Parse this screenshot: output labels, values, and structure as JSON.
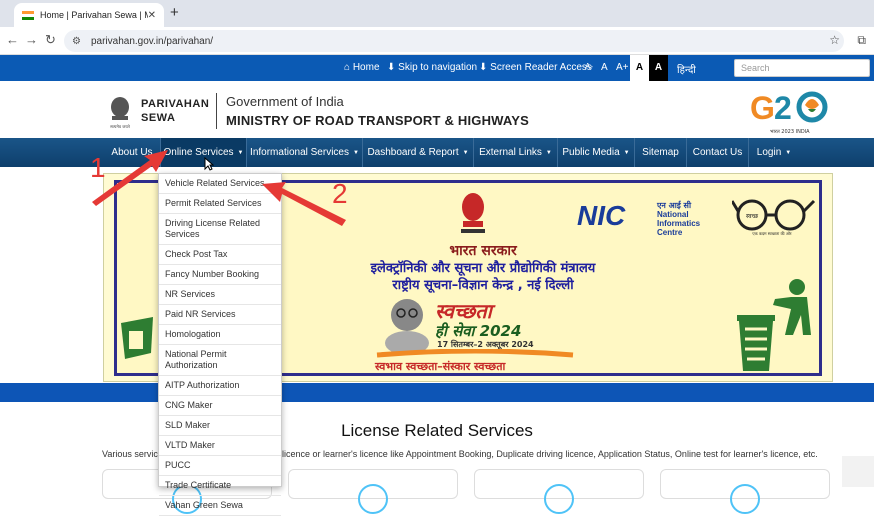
{
  "browser": {
    "tab_title": "Home | Parivahan Sewa | Minis",
    "new_tab": "+",
    "url": "parivahan.gov.in/parivahan/"
  },
  "utility": {
    "home": "Home",
    "skip": "Skip to navigation",
    "screen_reader": "Screen Reader Access",
    "font_small": "A-",
    "font_normal": "A",
    "font_large": "A+",
    "theme_light": "A",
    "theme_dark": "A",
    "lang": "हिन्दी",
    "search_placeholder": "Search"
  },
  "header": {
    "brand_line1": "PARIVAHAN",
    "brand_line2": "SEWA",
    "emblem_caption": "सत्यमेव जयते",
    "gov": "Government of India",
    "ministry": "MINISTRY OF ROAD TRANSPORT & HIGHWAYS",
    "g20_tag": "भारत 2023 INDIA"
  },
  "nav": {
    "items": [
      {
        "label": "About Us",
        "caret": false
      },
      {
        "label": "Online Services",
        "caret": true
      },
      {
        "label": "Informational Services",
        "caret": true
      },
      {
        "label": "Dashboard & Report",
        "caret": true
      },
      {
        "label": "External Links",
        "caret": true
      },
      {
        "label": "Public Media",
        "caret": true
      },
      {
        "label": "Sitemap",
        "caret": false
      },
      {
        "label": "Contact Us",
        "caret": false
      },
      {
        "label": "Login",
        "caret": true
      }
    ]
  },
  "dropdown": [
    "Vehicle Related Services",
    "Permit Related Services",
    "Driving License Related Services",
    "Check Post Tax",
    "Fancy Number Booking",
    "NR Services",
    "Paid NR Services",
    "Homologation",
    "National Permit Authorization",
    "AITP Authorization",
    "CNG Maker",
    "SLD Maker",
    "VLTD Maker",
    "PUCC",
    "Trade Certificate",
    "Vahan Green Sewa"
  ],
  "banner": {
    "line1": "भारत सरकार",
    "line2": "इलेक्ट्रॉनिकी और सूचना और प्रौद्योगिकी मंत्रालय",
    "line3": "राष्ट्रीय सूचना–विज्ञान केन्द्र , नई दिल्ली",
    "nic_en1": "National",
    "nic_en2": "Informatics",
    "nic_en3": "Centre",
    "nic_hi": "एन आई सी",
    "swachh": "स्वच्छता",
    "sewa": "ही सेवा 2024",
    "date": "17 सितम्बर–2 अक्तूबर 2024",
    "tagline": "स्वभाव स्वच्छता–संस्कार स्वच्छता",
    "glasses_text": "स्वच्छ",
    "glasses_sub": "एक कदम स्वच्छता की ओर"
  },
  "section": {
    "title": "License Related Services",
    "desc_left": "Various servic",
    "desc_right": "licence or learner's licence like Appointment Booking, Duplicate driving licence, Application Status, Online test for learner's licence, etc."
  },
  "annotations": {
    "one": "1",
    "two": "2"
  },
  "colors": {
    "utility_bar": "#0b5ab4",
    "nav_bar": "#1a5588",
    "annotation": "#e53935"
  }
}
